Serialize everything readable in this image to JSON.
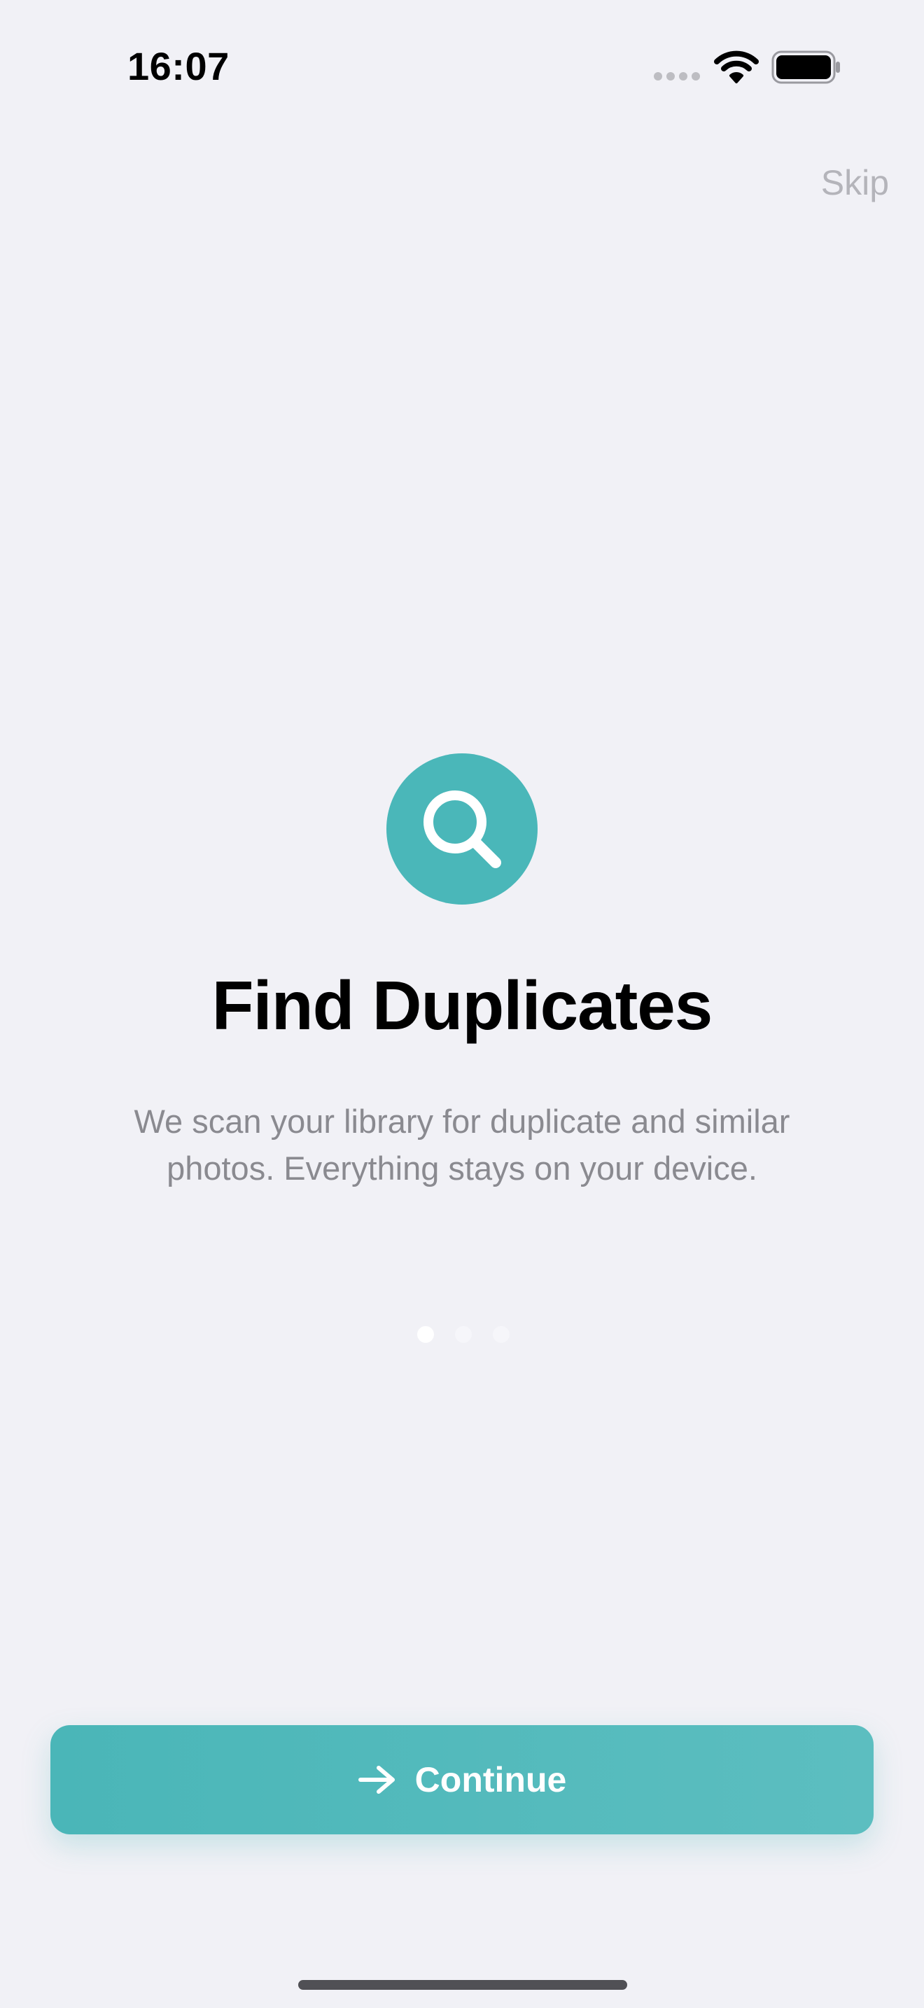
{
  "status_bar": {
    "time": "16:07"
  },
  "header": {
    "skip_label": "Skip"
  },
  "onboarding": {
    "icon": "magnifying-glass-icon",
    "title": "Find Duplicates",
    "subtitle": "We scan your library for duplicate and similar photos. Everything stays on your device.",
    "page_indicator": {
      "pages": 3,
      "current": 1
    }
  },
  "actions": {
    "continue_label": "Continue",
    "continue_icon": "arrow-right-icon"
  },
  "colors": {
    "accent": "#4AB7B9",
    "background": "#F1F1F6",
    "skip_text": "#B4B4BA",
    "subtitle_text": "#8A8A90"
  }
}
